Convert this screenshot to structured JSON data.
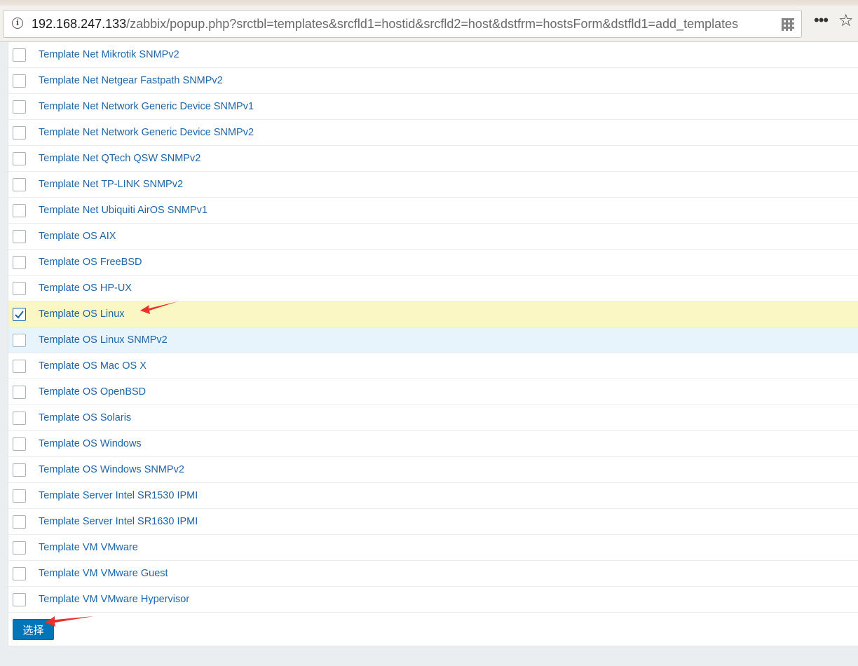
{
  "browser": {
    "url_host": "192.168.247.133",
    "url_path": "/zabbix/popup.php?srctbl=templates&srcfld1=hostid&srcfld2=host&dstfrm=hostsForm&dstfld1=add_templates"
  },
  "templates": [
    {
      "name": "Template Net Mikrotik SNMPv2",
      "checked": false
    },
    {
      "name": "Template Net Netgear Fastpath SNMPv2",
      "checked": false
    },
    {
      "name": "Template Net Network Generic Device SNMPv1",
      "checked": false
    },
    {
      "name": "Template Net Network Generic Device SNMPv2",
      "checked": false
    },
    {
      "name": "Template Net QTech QSW SNMPv2",
      "checked": false
    },
    {
      "name": "Template Net TP-LINK SNMPv2",
      "checked": false
    },
    {
      "name": "Template Net Ubiquiti AirOS SNMPv1",
      "checked": false
    },
    {
      "name": "Template OS AIX",
      "checked": false
    },
    {
      "name": "Template OS FreeBSD",
      "checked": false
    },
    {
      "name": "Template OS HP-UX",
      "checked": false
    },
    {
      "name": "Template OS Linux",
      "checked": true
    },
    {
      "name": "Template OS Linux SNMPv2",
      "checked": false,
      "hover": true
    },
    {
      "name": "Template OS Mac OS X",
      "checked": false
    },
    {
      "name": "Template OS OpenBSD",
      "checked": false
    },
    {
      "name": "Template OS Solaris",
      "checked": false
    },
    {
      "name": "Template OS Windows",
      "checked": false
    },
    {
      "name": "Template OS Windows SNMPv2",
      "checked": false
    },
    {
      "name": "Template Server Intel SR1530 IPMI",
      "checked": false
    },
    {
      "name": "Template Server Intel SR1630 IPMI",
      "checked": false
    },
    {
      "name": "Template VM VMware",
      "checked": false
    },
    {
      "name": "Template VM VMware Guest",
      "checked": false
    },
    {
      "name": "Template VM VMware Hypervisor",
      "checked": false
    }
  ],
  "select_button_label": "选择",
  "colors": {
    "link": "#1f65a6",
    "checked_row": "#fbf7c4",
    "hover_row": "#e8f4fb",
    "button": "#0275b8",
    "annotation_arrow": "#e8322a"
  },
  "icons": [
    "info-icon",
    "qr-code-icon",
    "more-icon",
    "bookmark-star-icon",
    "checkmark-icon",
    "annotation-arrow"
  ]
}
